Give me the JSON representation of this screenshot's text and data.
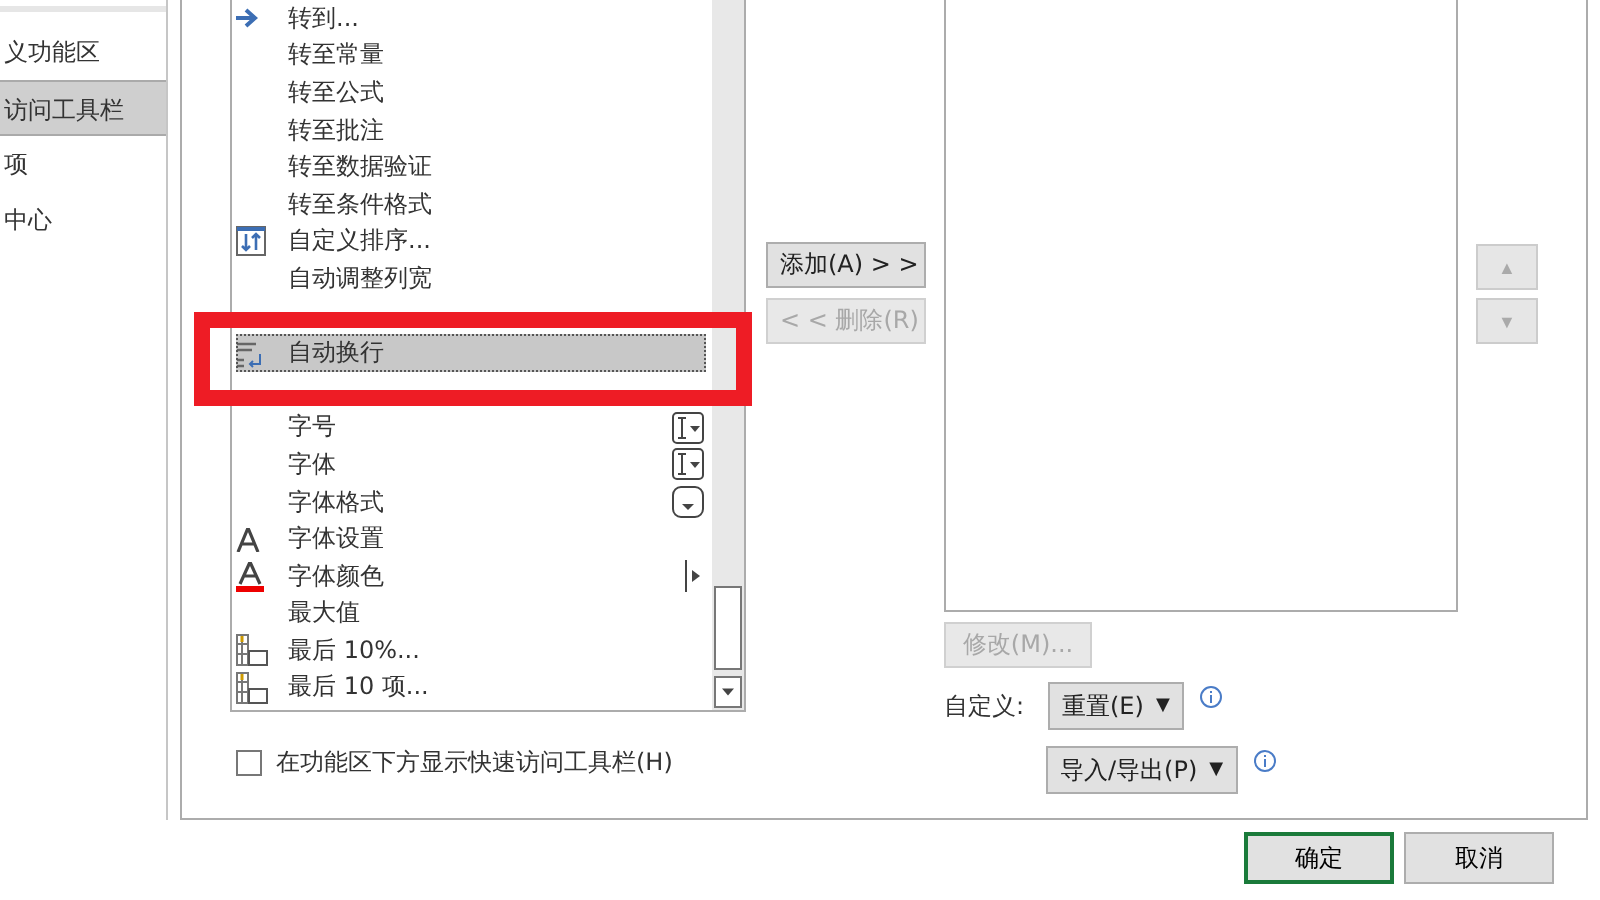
{
  "sidebar": {
    "items": [
      {
        "label": "义功能区",
        "selected": false
      },
      {
        "label": "访问工具栏",
        "selected": true
      },
      {
        "label": "项",
        "selected": false
      },
      {
        "label": "中心",
        "selected": false
      }
    ]
  },
  "commands": {
    "items": [
      {
        "kind": "arrow",
        "label": "转到...",
        "selected": false
      },
      {
        "kind": "plain",
        "label": "转至常量",
        "selected": false
      },
      {
        "kind": "plain",
        "label": "转至公式",
        "selected": false
      },
      {
        "kind": "plain",
        "label": "转至批注",
        "selected": false
      },
      {
        "kind": "plain",
        "label": "转至数据验证",
        "selected": false
      },
      {
        "kind": "plain",
        "label": "转至条件格式",
        "selected": false
      },
      {
        "kind": "sort",
        "label": "自定义排序...",
        "selected": false
      },
      {
        "kind": "plain",
        "label": "自动调整列宽",
        "selected": false
      },
      {
        "kind": "obscured"
      },
      {
        "kind": "wrap",
        "label": "自动换行",
        "selected": true
      },
      {
        "kind": "obscured"
      },
      {
        "kind": "combo",
        "label": "字号",
        "selected": false
      },
      {
        "kind": "combo",
        "label": "字体",
        "selected": false
      },
      {
        "kind": "dropdown",
        "label": "字体格式",
        "selected": false
      },
      {
        "kind": "font",
        "label": "字体设置",
        "selected": false
      },
      {
        "kind": "fontcolor",
        "label": "字体颜色",
        "selected": false
      },
      {
        "kind": "plain",
        "label": "最大值",
        "selected": false
      },
      {
        "kind": "grid",
        "label": "最后 10%...",
        "selected": false
      },
      {
        "kind": "grid",
        "label": "最后 10 项...",
        "selected": false
      }
    ]
  },
  "add_button": {
    "label": "添加(A) > >",
    "disabled": false
  },
  "remove_button": {
    "label": "< < 删除(R)",
    "disabled": true
  },
  "move_up": {
    "label": "▲",
    "disabled": true
  },
  "move_down": {
    "label": "▼",
    "disabled": true
  },
  "modify_button": {
    "label": "修改(M)...",
    "disabled": true
  },
  "customize_label": "自定义:",
  "reset_button": {
    "label": "重置(E)",
    "caret": "▼"
  },
  "import_export_button": {
    "label": "导入/导出(P)",
    "caret": "▼"
  },
  "show_below_ribbon": {
    "label": "在功能区下方显示快速访问工具栏(H)",
    "checked": false
  },
  "footer_buttons": [
    {
      "label": "确定",
      "default": true
    },
    {
      "label": "取消",
      "default": false
    }
  ]
}
